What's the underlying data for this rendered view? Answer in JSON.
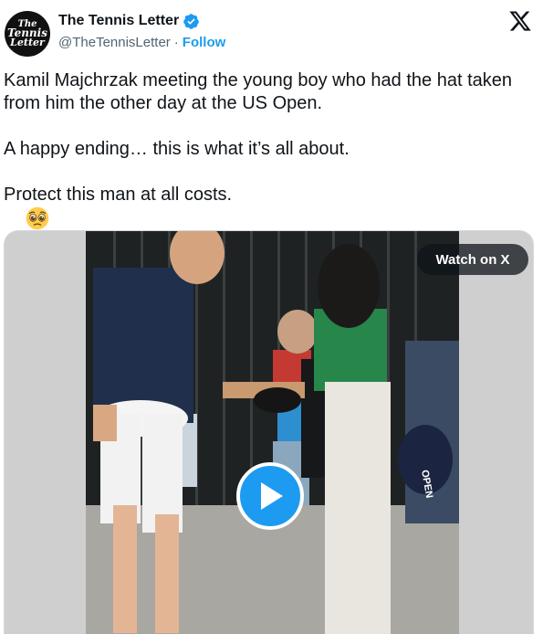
{
  "author": {
    "display_name": "The Tennis Letter",
    "handle": "@TheTennisLetter",
    "separator": "·",
    "follow_label": "Follow",
    "avatar_lines": [
      "The",
      "Tennis",
      "Letter"
    ]
  },
  "tweet": {
    "paragraphs": [
      "Kamil Majchrzak meeting the young boy who had the hat taken from him the other day at the US Open.",
      "A happy ending… this is what it’s all about.",
      "Protect this man at all costs."
    ],
    "emoji": "pleading-face-emoji"
  },
  "media": {
    "watch_label": "Watch on X",
    "play_icon": "play-icon",
    "hat_text": "OPEN"
  },
  "colors": {
    "accent": "#1d9bf0",
    "text": "#0f1419",
    "secondary": "#536471"
  }
}
